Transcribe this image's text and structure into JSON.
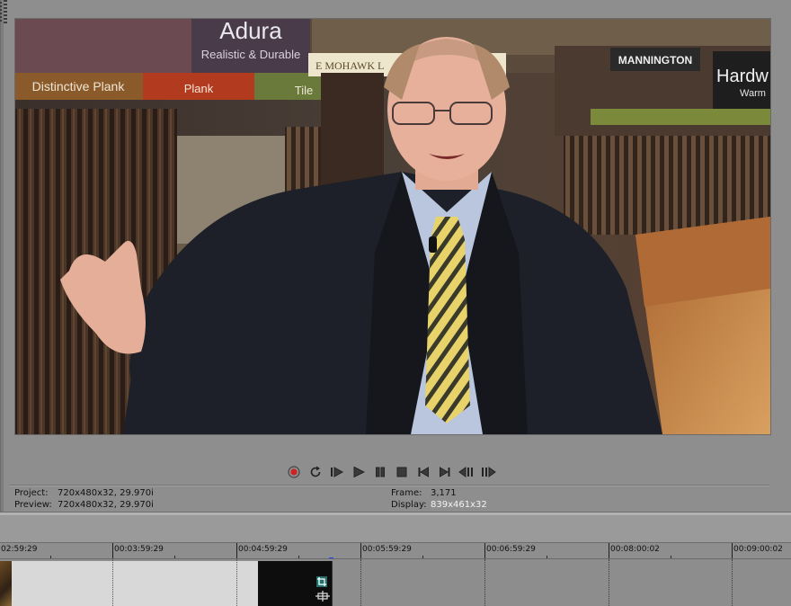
{
  "preview": {
    "project_label": "Project:",
    "project_value": "720x480x32, 29.970i",
    "preview_label": "Preview:",
    "preview_value": "720x480x32, 29.970i",
    "frame_label": "Frame:",
    "frame_value": "3,171",
    "display_label": "Display:",
    "display_value": "839x461x32"
  },
  "scene_signs": {
    "adura": "Adura",
    "adura_sub": "Realistic & Durable",
    "distinctive_plank": "Distinctive Plank",
    "plank": "Plank",
    "tile": "Tile",
    "mohawk": "E MOHAWK L",
    "mannington": "MANNINGTON",
    "hardwood": "Hardw",
    "hardwood_sub": "Warm"
  },
  "transport": {
    "buttons": [
      "record-icon",
      "loop-icon",
      "play-from-start-icon",
      "play-icon",
      "pause-icon",
      "stop-icon",
      "go-to-start-icon",
      "go-to-end-icon",
      "previous-frame-icon",
      "next-frame-icon"
    ]
  },
  "timeline": {
    "ruler_labels": [
      "02:59:29",
      "00:03:59:29",
      "00:04:59:29",
      "00:05:59:29",
      "00:06:59:29",
      "00:08:00:02",
      "00:09:00:02"
    ]
  },
  "colors": {
    "background": "#8e8e8e",
    "record": "#cc2222",
    "playhead": "#2340ff"
  }
}
